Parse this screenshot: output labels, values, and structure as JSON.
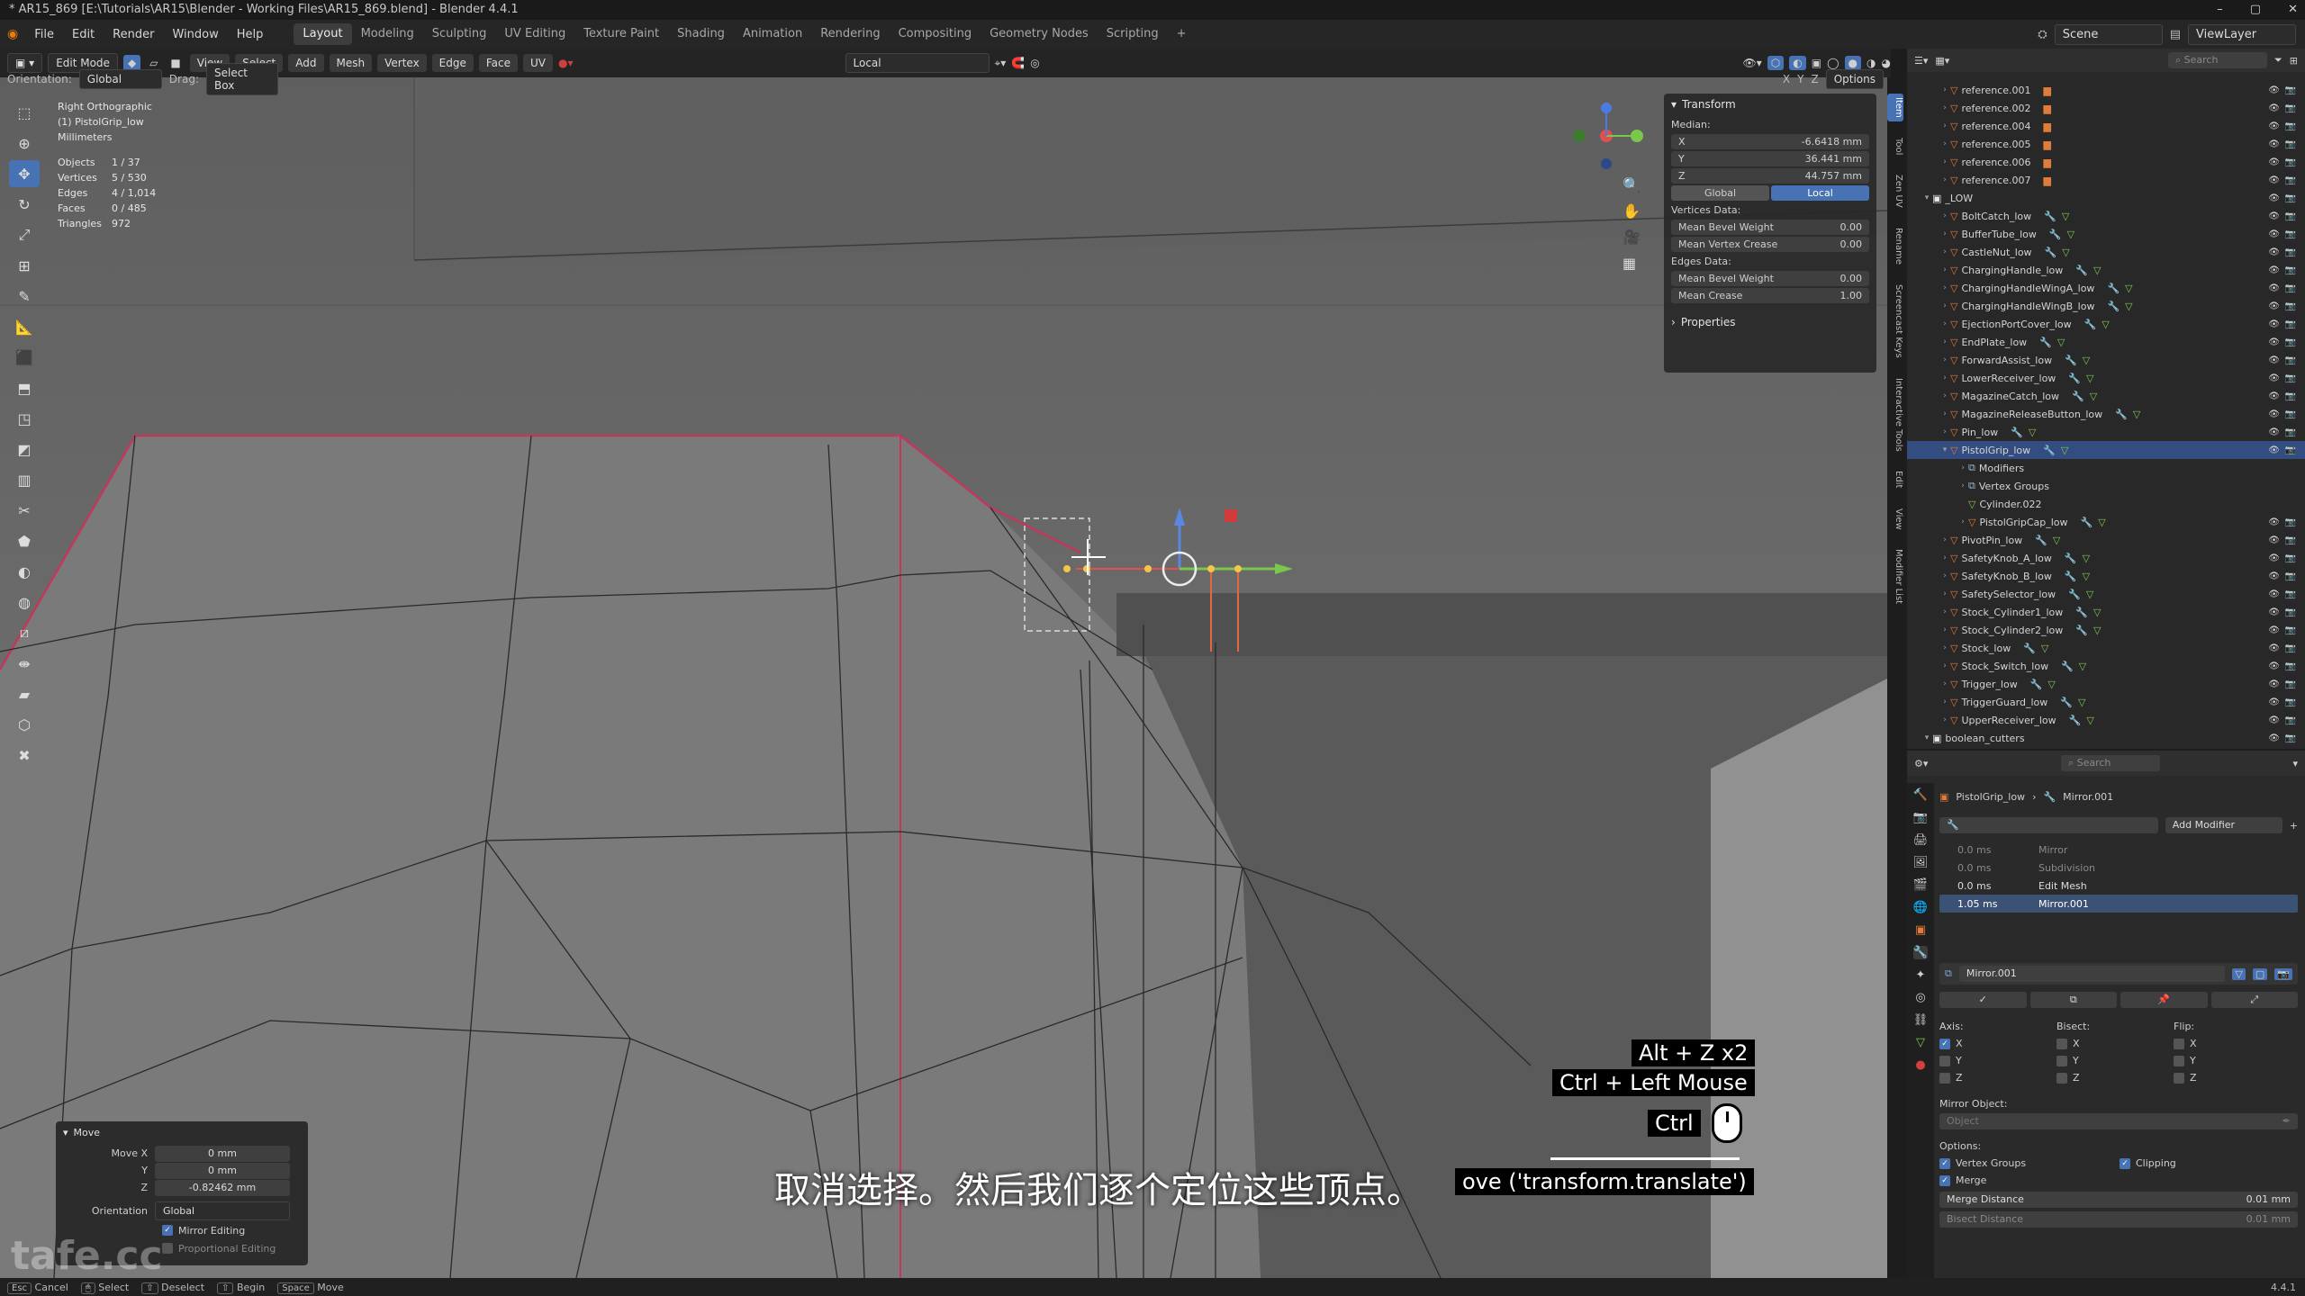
{
  "window": {
    "title": "* AR15_869 [E:\\Tutorials\\AR15\\Blender - Working Files\\AR15_869.blend] - Blender 4.4.1",
    "controls": [
      "–",
      "▢",
      "✕"
    ]
  },
  "menu": {
    "items": [
      "File",
      "Edit",
      "Render",
      "Window",
      "Help"
    ],
    "workspaces": [
      "Layout",
      "Modeling",
      "Sculpting",
      "UV Editing",
      "Texture Paint",
      "Shading",
      "Animation",
      "Rendering",
      "Compositing",
      "Geometry Nodes",
      "Scripting"
    ],
    "active_workspace": "Layout",
    "scene_label": "Scene",
    "viewlayer_label": "ViewLayer"
  },
  "viewport_header": {
    "mode": "Edit Mode",
    "menus": [
      "View",
      "Select",
      "Add",
      "Mesh",
      "Vertex",
      "Edge",
      "Face",
      "UV"
    ],
    "transform_space": "Local",
    "orientation_label": "Orientation:",
    "orientation_value": "Global",
    "drag_label": "Drag:",
    "drag_value": "Select Box",
    "axes": [
      "X",
      "Y",
      "Z"
    ],
    "options_label": "Options"
  },
  "viewport_info": {
    "view": "Right Orthographic",
    "object": "(1) PistolGrip_low",
    "units": "Millimeters",
    "stats": [
      {
        "label": "Objects",
        "value": "1 / 37"
      },
      {
        "label": "Vertices",
        "value": "5 / 530"
      },
      {
        "label": "Edges",
        "value": "4 / 1,014"
      },
      {
        "label": "Faces",
        "value": "0 / 485"
      },
      {
        "label": "Triangles",
        "value": "972"
      }
    ]
  },
  "n_panel": {
    "transform_title": "Transform",
    "median_label": "Median:",
    "median": [
      {
        "axis": "X",
        "value": "-6.6418 mm"
      },
      {
        "axis": "Y",
        "value": "36.441 mm"
      },
      {
        "axis": "Z",
        "value": "44.757 mm"
      }
    ],
    "space_global": "Global",
    "space_local": "Local",
    "vertices_data_label": "Vertices Data:",
    "vertices_data": [
      {
        "label": "Mean Bevel Weight",
        "value": "0.00"
      },
      {
        "label": "Mean Vertex Crease",
        "value": "0.00"
      }
    ],
    "edges_data_label": "Edges Data:",
    "edges_data": [
      {
        "label": "Mean Bevel Weight",
        "value": "0.00"
      },
      {
        "label": "Mean Crease",
        "value": "1.00"
      }
    ],
    "properties_title": "Properties",
    "side_tabs": [
      "Item",
      "Tool",
      "Zen UV",
      "Rename",
      "Screencast Keys",
      "Interactive Tools",
      "Edit",
      "View",
      "Modifier List"
    ]
  },
  "outliner": {
    "search_placeholder": "Search",
    "rows": [
      {
        "label": "reference.001",
        "indent": 2,
        "kind": "ref"
      },
      {
        "label": "reference.002",
        "indent": 2,
        "kind": "ref"
      },
      {
        "label": "reference.004",
        "indent": 2,
        "kind": "ref"
      },
      {
        "label": "reference.005",
        "indent": 2,
        "kind": "ref"
      },
      {
        "label": "reference.006",
        "indent": 2,
        "kind": "ref"
      },
      {
        "label": "reference.007",
        "indent": 2,
        "kind": "ref"
      },
      {
        "label": "_LOW",
        "indent": 1,
        "kind": "collection"
      },
      {
        "label": "BoltCatch_low",
        "indent": 2,
        "kind": "mesh"
      },
      {
        "label": "BufferTube_low",
        "indent": 2,
        "kind": "mesh"
      },
      {
        "label": "CastleNut_low",
        "indent": 2,
        "kind": "mesh"
      },
      {
        "label": "ChargingHandle_low",
        "indent": 2,
        "kind": "mesh"
      },
      {
        "label": "ChargingHandleWingA_low",
        "indent": 2,
        "kind": "mesh"
      },
      {
        "label": "ChargingHandleWingB_low",
        "indent": 2,
        "kind": "mesh"
      },
      {
        "label": "EjectionPortCover_low",
        "indent": 2,
        "kind": "mesh"
      },
      {
        "label": "EndPlate_low",
        "indent": 2,
        "kind": "mesh"
      },
      {
        "label": "ForwardAssist_low",
        "indent": 2,
        "kind": "mesh"
      },
      {
        "label": "LowerReceiver_low",
        "indent": 2,
        "kind": "mesh"
      },
      {
        "label": "MagazineCatch_low",
        "indent": 2,
        "kind": "mesh"
      },
      {
        "label": "MagazineReleaseButton_low",
        "indent": 2,
        "kind": "mesh"
      },
      {
        "label": "Pin_low",
        "indent": 2,
        "kind": "mesh"
      },
      {
        "label": "PistolGrip_low",
        "indent": 2,
        "kind": "mesh",
        "selected": true
      },
      {
        "label": "Modifiers",
        "indent": 3,
        "kind": "sub"
      },
      {
        "label": "Vertex Groups",
        "indent": 3,
        "kind": "sub"
      },
      {
        "label": "Cylinder.022",
        "indent": 3,
        "kind": "data"
      },
      {
        "label": "PistolGripCap_low",
        "indent": 3,
        "kind": "mesh"
      },
      {
        "label": "PivotPin_low",
        "indent": 2,
        "kind": "mesh"
      },
      {
        "label": "SafetyKnob_A_low",
        "indent": 2,
        "kind": "mesh"
      },
      {
        "label": "SafetyKnob_B_low",
        "indent": 2,
        "kind": "mesh"
      },
      {
        "label": "SafetySelector_low",
        "indent": 2,
        "kind": "mesh"
      },
      {
        "label": "Stock_Cylinder1_low",
        "indent": 2,
        "kind": "mesh"
      },
      {
        "label": "Stock_Cylinder2_low",
        "indent": 2,
        "kind": "mesh"
      },
      {
        "label": "Stock_low",
        "indent": 2,
        "kind": "mesh"
      },
      {
        "label": "Stock_Switch_low",
        "indent": 2,
        "kind": "mesh"
      },
      {
        "label": "Trigger_low",
        "indent": 2,
        "kind": "mesh"
      },
      {
        "label": "TriggerGuard_low",
        "indent": 2,
        "kind": "mesh"
      },
      {
        "label": "UpperReceiver_low",
        "indent": 2,
        "kind": "mesh"
      },
      {
        "label": "boolean_cutters",
        "indent": 1,
        "kind": "collection"
      }
    ]
  },
  "properties": {
    "search_placeholder": "Search",
    "breadcrumb_object": "PistolGrip_low",
    "breadcrumb_modifier": "Mirror.001",
    "add_modifier": "Add Modifier",
    "timings": [
      {
        "time": "0.0 ms",
        "name": "Mirror"
      },
      {
        "time": "0.0 ms",
        "name": "Subdivision"
      },
      {
        "time": "0.0 ms",
        "name": "Edit Mesh"
      },
      {
        "time": "1.05 ms",
        "name": "Mirror.001"
      }
    ],
    "modifier_name": "Mirror.001",
    "axis_label": "Axis:",
    "bisect_label": "Bisect:",
    "flip_label": "Flip:",
    "axis_letters": [
      "X",
      "Y",
      "Z"
    ],
    "mirror_object_label": "Mirror Object:",
    "mirror_object_placeholder": "Object",
    "options_label": "Options:",
    "vertex_groups": "Vertex Groups",
    "clipping": "Clipping",
    "merge": "Merge",
    "merge_distance_label": "Merge Distance",
    "merge_distance_value": "0.01 mm",
    "bisect_distance_label": "Bisect Distance",
    "bisect_distance_value": "0.01 mm"
  },
  "move_panel": {
    "title": "Move",
    "move_x_label": "Move X",
    "move_x": "0 mm",
    "y_label": "Y",
    "y": "0 mm",
    "z_label": "Z",
    "z": "-0.82462 mm",
    "orientation_label": "Orientation",
    "orientation": "Global",
    "mirror_editing": "Mirror Editing",
    "proportional_editing": "Proportional Editing"
  },
  "overlays": {
    "key1": "Alt + Z x2",
    "key2": "Ctrl + Left Mouse",
    "key3": "Ctrl",
    "operator": "ove ('transform.translate')",
    "subtitle": "取消选择。然后我们逐个定位这些顶点。",
    "watermark": "tafe.cc"
  },
  "status_bar": {
    "items": [
      {
        "key": "Esc",
        "label": "Cancel"
      },
      {
        "key": "LMB",
        "label": "Select"
      },
      {
        "key": "Shift",
        "label": "Deselect"
      },
      {
        "key": "Shift",
        "label": "Begin"
      },
      {
        "key": "Space",
        "label": "Move"
      }
    ],
    "version": "4.4.1"
  },
  "colors": {
    "accent": "#4772b3",
    "selected_row": "#334d80",
    "mesh_icon": "#e07b39",
    "mod_icon": "#7fc94f",
    "seam_edge": "#c0395a"
  }
}
